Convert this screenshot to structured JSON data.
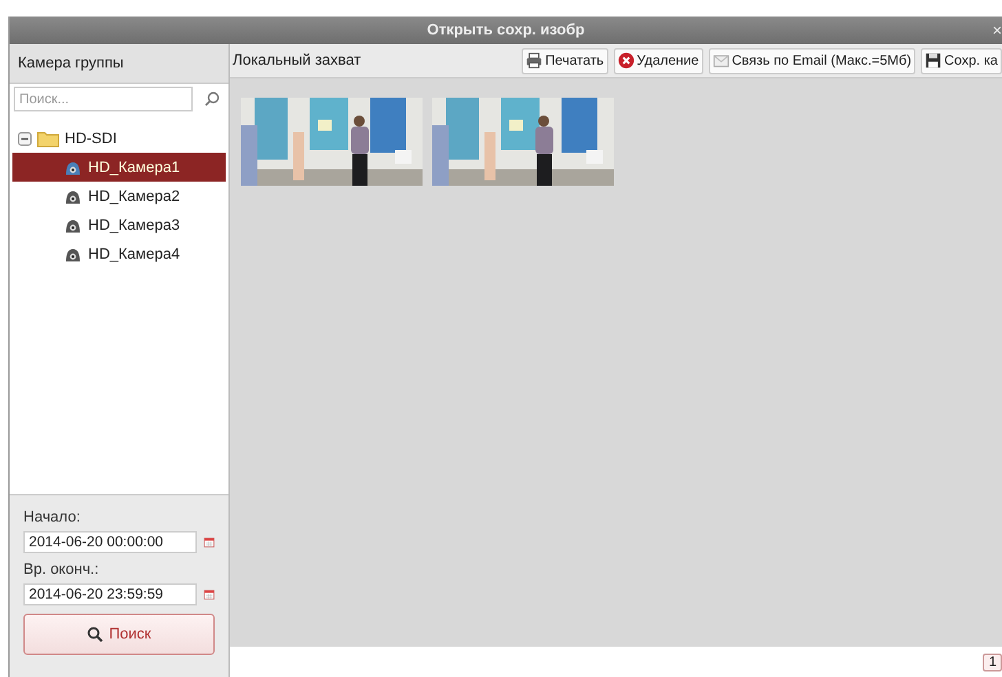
{
  "window": {
    "title": "Открыть сохр. изобр",
    "close": "×"
  },
  "sidebar": {
    "title": "Камера группы",
    "search": {
      "placeholder": "Поиск..."
    },
    "tree": [
      {
        "label": "HD-SDI",
        "expanded": true,
        "children": [
          {
            "label": "HD_Камера1",
            "selected": true
          },
          {
            "label": "HD_Камера2",
            "selected": false
          },
          {
            "label": "HD_Камера3",
            "selected": false
          },
          {
            "label": "HD_Камера4",
            "selected": false
          }
        ]
      }
    ],
    "start_label": "Начало:",
    "start_value": "2014-06-20 00:00:00",
    "end_label": "Вр. оконч.:",
    "end_value": "2014-06-20 23:59:59",
    "search_button": "Поиск"
  },
  "content": {
    "title": "Локальный захват",
    "toolbar": [
      {
        "kind": "print",
        "label": "Печатать"
      },
      {
        "kind": "delete",
        "label": "Удаление"
      },
      {
        "kind": "email",
        "label": "Связь по Email (Макс.=5Мб)"
      },
      {
        "kind": "save",
        "label": "Сохр. ка"
      }
    ],
    "thumbnails": [
      {
        "kind": "picture"
      },
      {
        "kind": "picture"
      }
    ],
    "pagination": [
      "1"
    ]
  }
}
